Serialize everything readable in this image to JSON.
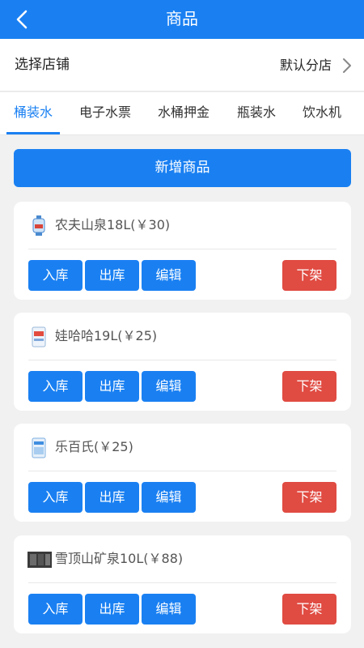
{
  "header": {
    "title": "商品"
  },
  "store": {
    "label": "选择店铺",
    "value": "默认分店"
  },
  "tabs": [
    {
      "label": "桶装水",
      "active": true
    },
    {
      "label": "电子水票",
      "active": false
    },
    {
      "label": "水桶押金",
      "active": false
    },
    {
      "label": "瓶装水",
      "active": false
    },
    {
      "label": "饮水机",
      "active": false
    }
  ],
  "add_button": "新增商品",
  "products": [
    {
      "name": "农夫山泉18L(￥30)",
      "image": "water-bucket-icon"
    },
    {
      "name": "娃哈哈19L(￥25)",
      "image": "water-bottle-icon"
    },
    {
      "name": "乐百氏(￥25)",
      "image": "water-bottle-icon"
    },
    {
      "name": "雪顶山矿泉10L(￥88)",
      "image": "water-photo"
    }
  ],
  "actions": {
    "stock_in": "入库",
    "stock_out": "出库",
    "edit": "编辑",
    "delist": "下架"
  },
  "colors": {
    "primary": "#1a80f2",
    "danger": "#e04b42",
    "background": "#f1f1f1"
  }
}
